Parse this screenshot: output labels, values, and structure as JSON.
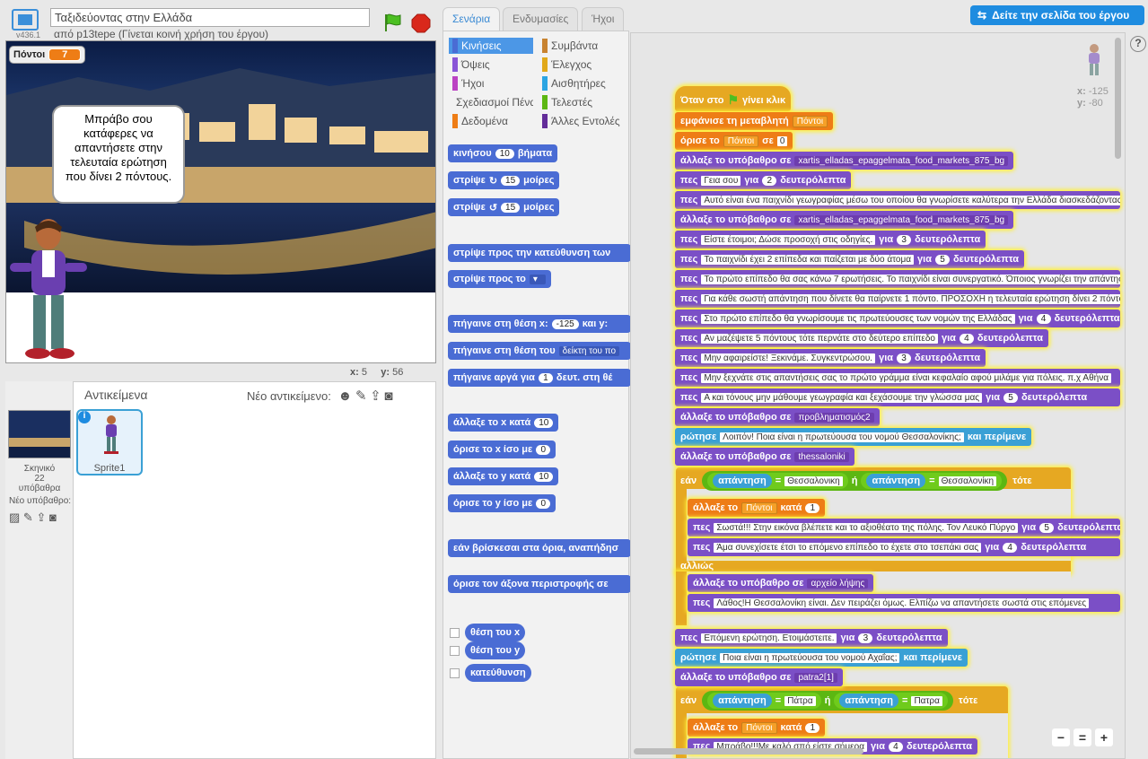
{
  "header": {
    "version": "v436.1",
    "project_title": "Ταξιδεύοντας στην Ελλάδα",
    "byline": "από p13tepe (Γίνεται κοινή χρήση του έργου)"
  },
  "stage": {
    "var_name": "Πόντοι",
    "var_value": "7",
    "bubble": "Μπράβο σου κατάφερες να απαντήσετε στην τελευταία ερώτηση που δίνει 2 πόντους.",
    "x_label": "x:",
    "x": "5",
    "y_label": "y:",
    "y": "56"
  },
  "sprites": {
    "header": "Αντικείμενα",
    "new_sprite": "Νέο αντικείμενο:",
    "stage_name": "Σκηνικό",
    "stage_bgs": "22 υπόβαθρα",
    "new_bg": "Νέο υπόβαθρο:",
    "sprite1": "Sprite1"
  },
  "tabs": [
    "Σενάρια",
    "Ενδυμασίες",
    "Ήχοι"
  ],
  "see_project": "Δείτε την σελίδα του έργου",
  "categories": [
    {
      "label": "Κινήσεις",
      "color": "#4a6cd4"
    },
    {
      "label": "Συμβάντα",
      "color": "#c88330"
    },
    {
      "label": "Όψεις",
      "color": "#8a55d7"
    },
    {
      "label": "Έλεγχος",
      "color": "#e1a91a"
    },
    {
      "label": "Ήχοι",
      "color": "#bb42c3"
    },
    {
      "label": "Αισθητήρες",
      "color": "#2ca5e2"
    },
    {
      "label": "Σχεδιασμοί Πένας",
      "color": "#0e9a6c"
    },
    {
      "label": "Τελεστές",
      "color": "#5cb712"
    },
    {
      "label": "Δεδομένα",
      "color": "#ee7d16"
    },
    {
      "label": "Άλλες Εντολές",
      "color": "#632d99"
    }
  ],
  "palette": {
    "move": "κινήσου",
    "steps": "βήματα",
    "n10": "10",
    "turn": "στρίψε",
    "n15": "15",
    "deg": "μοίρες",
    "point_dir": "στρίψε προς την κατεύθυνση των",
    "point_to": "στρίψε προς το",
    "goto_xy": "πήγαινε στη θέση x:",
    "gx": "-125",
    "and_y": "και y:",
    "goto": "πήγαινε στη θέση του",
    "mouse": "δείκτη του πο",
    "glide": "πήγαινε αργά για",
    "n1": "1",
    "glide2": "δευτ. στη θέ",
    "chx": "άλλαξε το x κατά",
    "setx": "όρισε το x ίσο με",
    "n0": "0",
    "chy": "άλλαξε το y κατά",
    "sety": "όρισε το y ίσο με",
    "bounce": "εάν βρίσκεσαι στα όρια, αναπήδησ",
    "rot": "όρισε τον άξονα περιστροφής σε",
    "xpos": "θέση του x",
    "ypos": "θέση του y",
    "dir": "κατεύθυνση"
  },
  "script": {
    "hat": "Όταν στο",
    "hat2": "γίνει κλικ",
    "show_var": "εμφάνισε τη μεταβλητή",
    "var": "Πόντοι",
    "set": "όρισε το",
    "to": "σε",
    "zero": "0",
    "switch_bg": "άλλαξε το υπόβαθρο σε",
    "bg1": "xartis_elladas_epaggelmata_food_markets_875_bg",
    "say": "πες",
    "for": "για",
    "secs": "δευτερόλεπτα",
    "s1": "Γεια σου",
    "n2": "2",
    "s2": "Αυτό είναι ένα παιχνίδι γεωγραφίας μέσω του οποίου θα γνωρίσετε καλύτερα την Ελλάδα διασκεδάζοντας",
    "s3": "Είστε έτοιμοι; Δώσε προσοχή στις οδηγίες.",
    "n3": "3",
    "s4": "Το παιχνίδι έχει 2 επίπεδα και παίζεται με  δύο άτομα",
    "n5": "5",
    "s5": "Το πρώτο επίπεδο θα σας κάνω 7 ερωτήσεις. Το παιχνίδι είναι συνεργατικό. Όποιος γνωρίζει την απάντηση",
    "s6": "Για κάθε σωστή απάντηση που δίνετε θα παίρνετε 1 πόντο. ΠΡΟΣΟΧΗ η τελευταία ερώτηση δίνει 2 πόντους",
    "s7": "Στο πρώτο επίπεδο θα γνωρίσουμε τις πρωτεύουσες των νομών της Ελλάδας",
    "n4": "4",
    "s8": "Αν μαζέψετε 5 πόντους τότε περνάτε στο δεύτερο επίπεδο",
    "s9": "Μην αφαιρείστε! Ξεκινάμε. Συγκεντρώσου.",
    "s10": "Μην ξεχνάτε στις απαντήσεις σας το πρώτο γράμμα είναι κεφαλαίο αφού μιλάμε για πόλεις. π.χ Αθήνα",
    "s11": "Α και τόνους μην μάθουμε γεωγραφία και ξεχάσουμε την γλώσσα μας",
    "bg2": "προβληματισμός2",
    "ask": "ρώτησε",
    "wait": "και περίμενε",
    "q1": "Λοιπόν! Ποια είναι η πρωτεύουσα του νομού Θεσσαλονίκης;",
    "bg3": "thessaloniki",
    "if": "εάν",
    "answer": "απάντηση",
    "eq": "=",
    "or": "ή",
    "then": "τότε",
    "a1": "Θεσσαλονικη",
    "a1b": "Θεσσαλονίκη",
    "change": "άλλαξε το",
    "by": "κατά",
    "one": "1",
    "s12": "Σωστά!!! Στην εικόνα βλέπετε και το αξιοθέατο της πόλης. Τον Λευκό Πύργο",
    "s13": "Άμα συνεχίσετε έτσι το επόμενο επίπεδο το έχετε στο τσεπάκι σας",
    "else": "αλλιώς",
    "bg4": "αρχείο λήψης",
    "s14": "Λάθος!Η Θεσσαλονίκη είναι. Δεν πειράζει όμως. Ελπίζω να απαντήσετε σωστά στις επόμενες",
    "s15": "Επόμενη ερώτηση. Ετοιμάστειτε.",
    "q2": "Ποια είναι η πρωτεύουσα του νομού Αχαΐας;",
    "bg5": "patra2[1]",
    "a2": "Πάτρα",
    "a2b": "Πατρα",
    "s16": "Μπράβο!!!Με καλό σπό είστε σήμερα"
  },
  "sprite_info": {
    "x_label": "x:",
    "x": "-125",
    "y_label": "y:",
    "y": "-80"
  },
  "zoom": {
    "minus": "−",
    "reset": "=",
    "plus": "+"
  },
  "help": "?"
}
